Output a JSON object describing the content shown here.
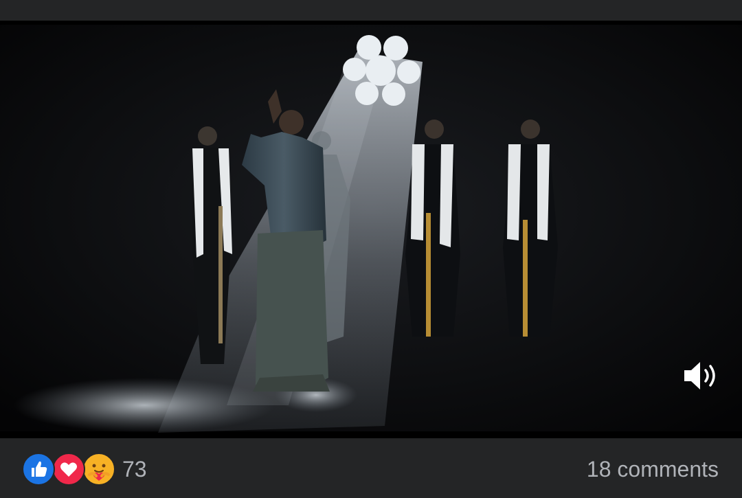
{
  "video": {
    "scene": "video-frame",
    "sound_icon": "speaker-on-icon"
  },
  "footer": {
    "reactions": [
      {
        "name": "like",
        "icon": "thumbs-up-icon",
        "color": "#1b74e4"
      },
      {
        "name": "love",
        "icon": "heart-icon",
        "color": "#f0284a"
      },
      {
        "name": "care",
        "icon": "care-hug-icon",
        "color": "#f7b125"
      }
    ],
    "reaction_count": "73",
    "comments_label": "18 comments"
  },
  "colors": {
    "background": "#242526",
    "secondary_text": "#b0b3b8"
  }
}
